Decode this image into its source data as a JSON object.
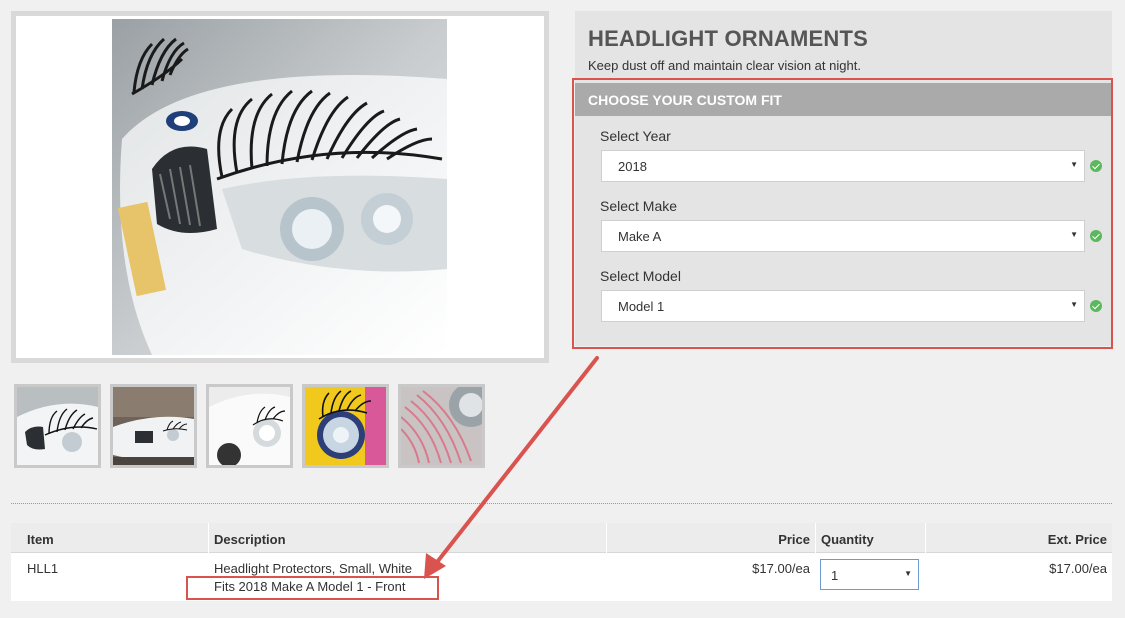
{
  "product": {
    "title": "HEADLIGHT ORNAMENTS",
    "tagline": "Keep dust off and maintain clear vision at night."
  },
  "custom_fit": {
    "header": "CHOOSE YOUR CUSTOM FIT",
    "year": {
      "label": "Select Year",
      "value": "2018"
    },
    "make": {
      "label": "Select Make",
      "value": "Make A"
    },
    "model": {
      "label": "Select Model",
      "value": "Model 1"
    }
  },
  "images": {
    "main": "car-headlight-eyelashes-photo",
    "thumbnails": [
      "white-car-eyelashes-closeup",
      "white-car-front-eyelashes",
      "white-beetle-eyelashes",
      "yellow-headlight-eyelashes",
      "pink-eyelashes-closeup"
    ]
  },
  "table": {
    "headers": {
      "item": "Item",
      "description": "Description",
      "price": "Price",
      "quantity": "Quantity",
      "ext_price": "Ext. Price"
    },
    "row": {
      "item": "HLL1",
      "description": "Headlight Protectors, Small, White",
      "fit_note": "Fits 2018 Make A Model 1 - Front",
      "price": "$17.00/ea",
      "quantity": "1",
      "ext_price": "$17.00/ea"
    }
  },
  "colors": {
    "highlight": "#d9534f",
    "check": "#5cb85c",
    "fit_header": "#aaaaaa"
  },
  "icons": {
    "select_arrow": "chevron-down-icon",
    "valid": "check-circle-icon"
  }
}
